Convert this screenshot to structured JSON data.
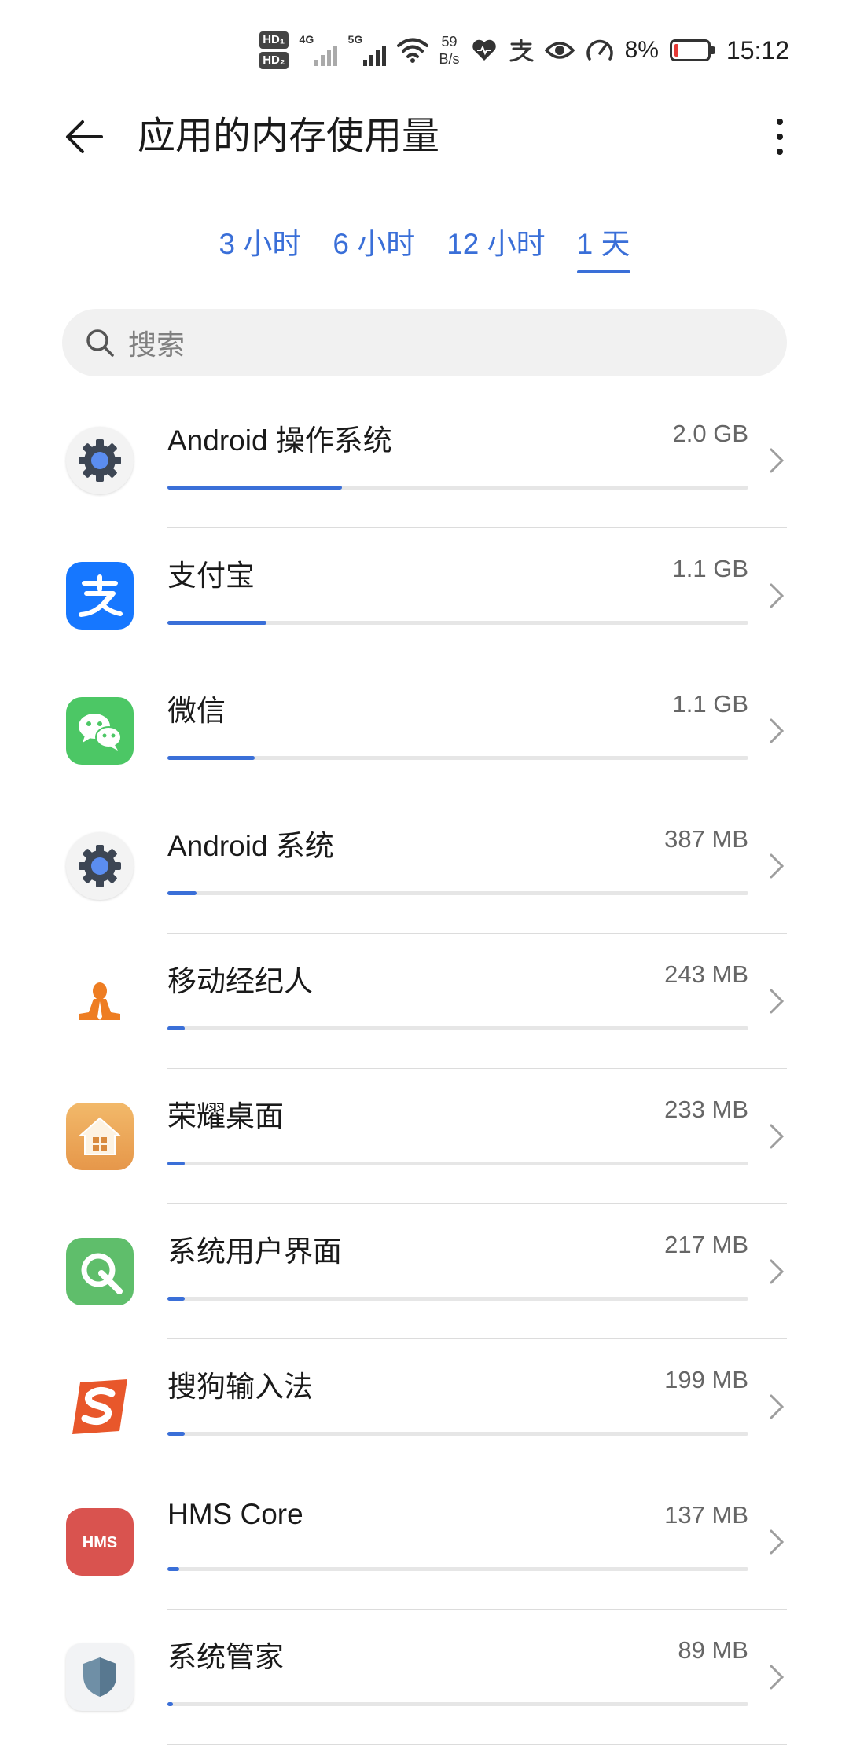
{
  "status_bar": {
    "hd1": "HD₁",
    "hd2": "HD₂",
    "signal1_label": "4G",
    "signal2_label": "5G",
    "net_speed_value": "59",
    "net_speed_unit": "B/s",
    "battery_percent": "8%",
    "battery_level": 0.08,
    "time": "15:12",
    "icons": [
      "wifi-icon",
      "health-icon",
      "alipay-status-icon",
      "eye-icon",
      "speedometer-icon"
    ]
  },
  "appbar": {
    "title": "应用的内存使用量",
    "back_icon": "arrow-left-icon",
    "more_icon": "more-vertical-icon"
  },
  "tabs": [
    {
      "label": "3 小时",
      "active": false
    },
    {
      "label": "6 小时",
      "active": false
    },
    {
      "label": "12 小时",
      "active": false
    },
    {
      "label": "1 天",
      "active": true
    }
  ],
  "search": {
    "placeholder": "搜索"
  },
  "apps": [
    {
      "name": "Android 操作系统",
      "size": "2.0 GB",
      "usage": 0.3,
      "icon": "android-system-gear-icon"
    },
    {
      "name": "支付宝",
      "size": "1.1 GB",
      "usage": 0.17,
      "icon": "alipay-icon"
    },
    {
      "name": "微信",
      "size": "1.1 GB",
      "usage": 0.15,
      "icon": "wechat-icon"
    },
    {
      "name": "Android 系统",
      "size": "387 MB",
      "usage": 0.05,
      "icon": "android-gear-icon"
    },
    {
      "name": "移动经纪人",
      "size": "243 MB",
      "usage": 0.03,
      "icon": "broker-person-icon"
    },
    {
      "name": "荣耀桌面",
      "size": "233 MB",
      "usage": 0.03,
      "icon": "honor-launcher-home-icon"
    },
    {
      "name": "系统用户界面",
      "size": "217 MB",
      "usage": 0.03,
      "icon": "system-ui-icon"
    },
    {
      "name": "搜狗输入法",
      "size": "199 MB",
      "usage": 0.03,
      "icon": "sogou-input-icon"
    },
    {
      "name": "HMS Core",
      "size": "137 MB",
      "usage": 0.02,
      "icon": "hms-core-icon"
    },
    {
      "name": "系统管家",
      "size": "89 MB",
      "usage": 0.01,
      "icon": "system-manager-shield-icon"
    }
  ],
  "colors": {
    "accent": "#3a6fd8",
    "track": "#e6e6e6"
  }
}
